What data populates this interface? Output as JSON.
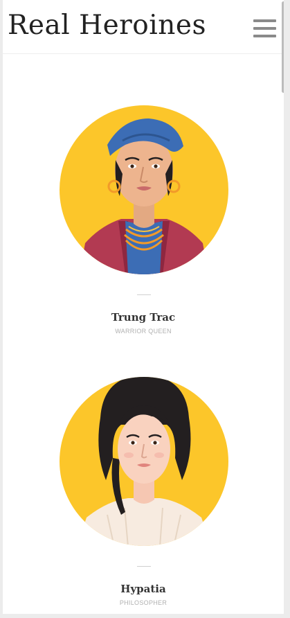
{
  "site": {
    "logo_text": "Real Heroines"
  },
  "colors": {
    "portrait_bg": "#fcc62a",
    "accent_dark": "#222222",
    "text_muted": "#b0b0b0"
  },
  "heroines": [
    {
      "name": "Trung Trac",
      "role": "WARRIOR QUEEN"
    },
    {
      "name": "Hypatia",
      "role": "PHILOSOPHER"
    }
  ]
}
